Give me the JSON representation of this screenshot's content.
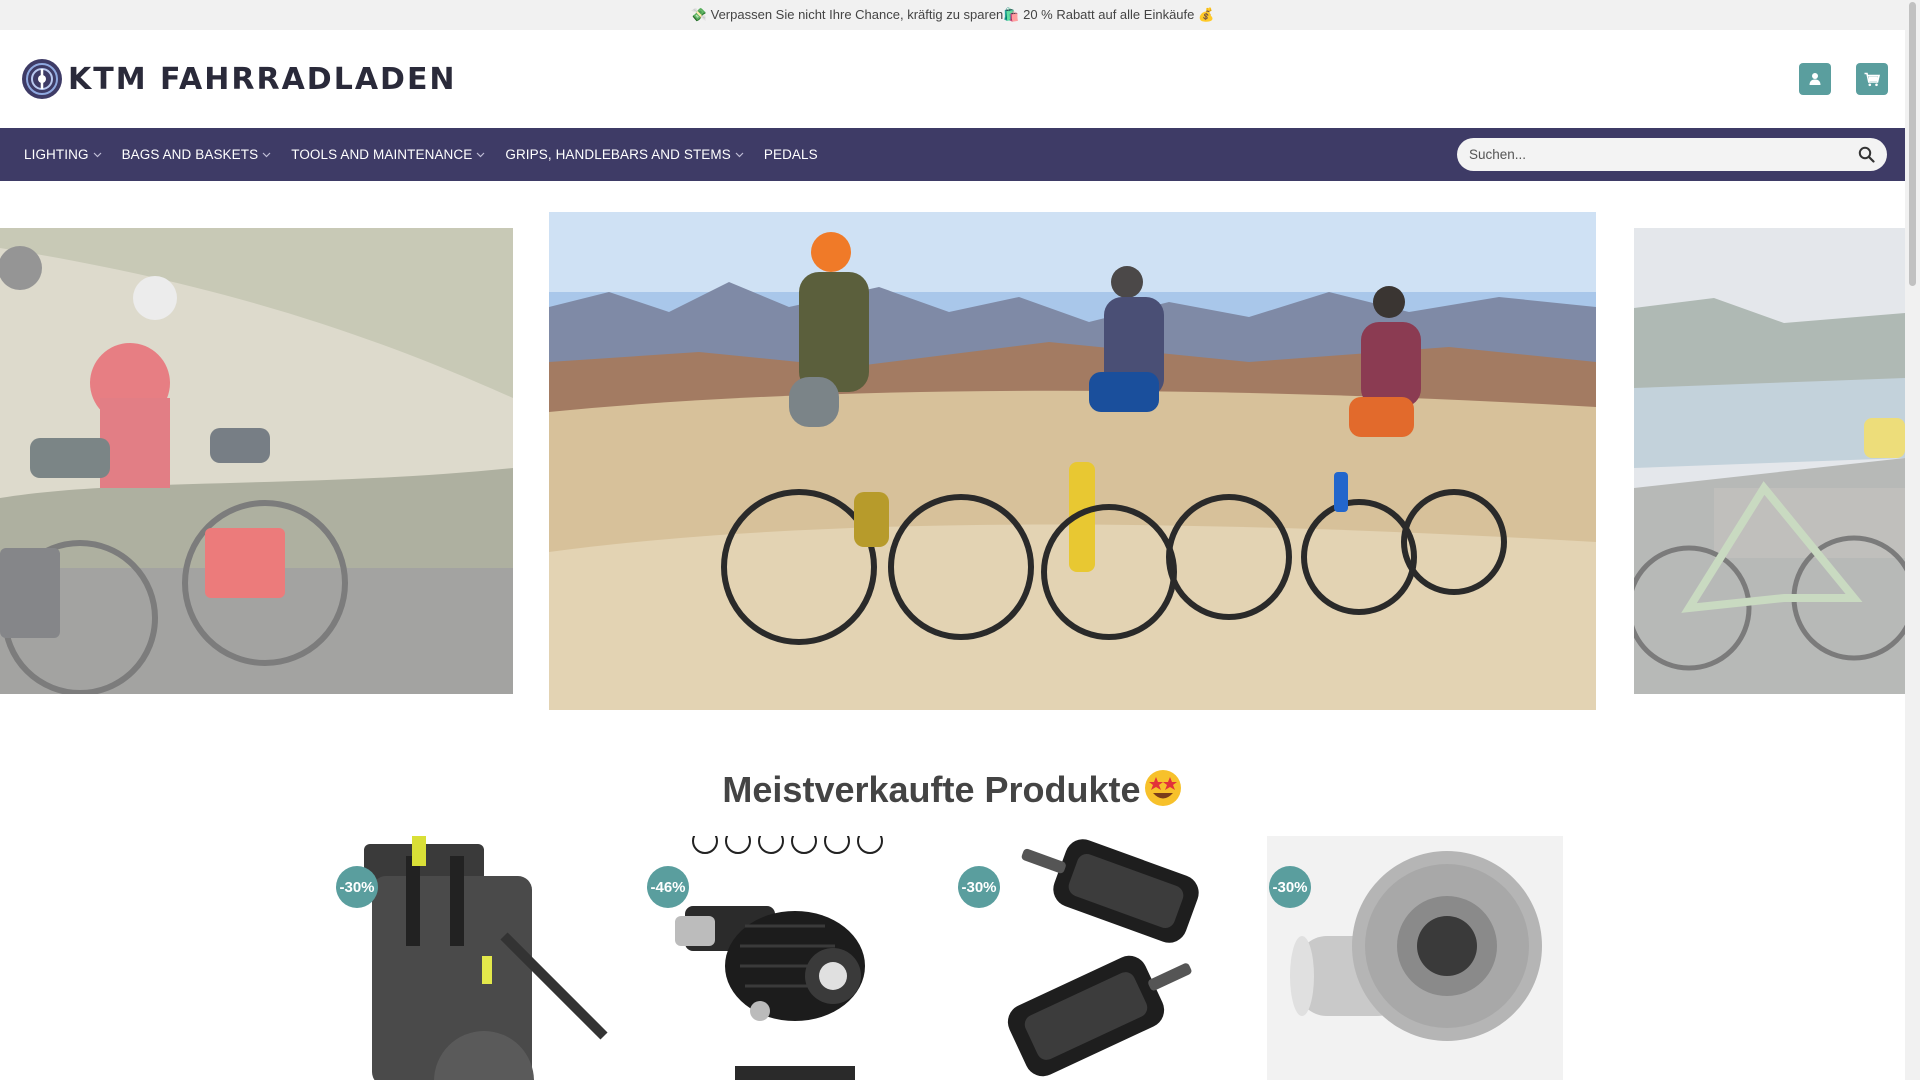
{
  "announcement": {
    "text": "💸 Verpassen Sie nicht Ihre Chance, kräftig zu sparen🛍️ 20 % Rabatt auf alle Einkäufe 💰"
  },
  "header": {
    "logo_text": "KTM FAHRRADLADEN",
    "icons": {
      "account": "user-icon",
      "cart": "cart-icon"
    },
    "accent_color": "#5a9e9e"
  },
  "nav": {
    "background": "#3e3b66",
    "items": [
      {
        "label": "LIGHTING",
        "has_dropdown": true
      },
      {
        "label": "BAGS AND BASKETS",
        "has_dropdown": true
      },
      {
        "label": "TOOLS AND MAINTENANCE",
        "has_dropdown": true
      },
      {
        "label": "GRIPS, HANDLEBARS AND STEMS",
        "has_dropdown": true
      },
      {
        "label": "PEDALS",
        "has_dropdown": false
      }
    ],
    "search": {
      "placeholder": "Suchen...",
      "value": ""
    }
  },
  "slider": {
    "slides": [
      "left-slide",
      "main-slide",
      "right-slide"
    ]
  },
  "bestsellers": {
    "title": "Meistverkaufte Produkte",
    "title_emoji": "star-struck-emoji",
    "products": [
      {
        "discount": "-30%",
        "image": "grey-pannier-bag"
      },
      {
        "discount": "-46%",
        "image": "bike-light"
      },
      {
        "discount": "-30%",
        "image": "black-pedals"
      },
      {
        "discount": "-30%",
        "image": "bottom-bracket-tool"
      }
    ]
  }
}
